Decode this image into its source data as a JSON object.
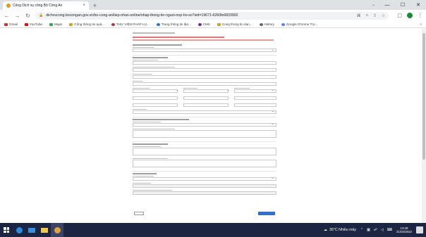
{
  "browser": {
    "tab_title": "Cổng Dịch vụ công Bộ Công An",
    "tab_close": "×",
    "new_tab": "+",
    "url": "dichvucong.bocongan.gov.vn/bo-cong-an/tiep-nhan-online/nhap-thong-tin-nguoi-nop-ho-so?sid=19671-6260fe6833992",
    "bookmarks": [
      {
        "label": "Gmail",
        "color": "#d93025"
      },
      {
        "label": "YouTube",
        "color": "#ff0000"
      },
      {
        "label": "Maps",
        "color": "#34a853"
      },
      {
        "label": "Cổng thông tin quả...",
        "color": "#d8a020"
      },
      {
        "label": "THƯ VIỆN PHÁP LU...",
        "color": "#c62828"
      },
      {
        "label": "Trang thông tin địa...",
        "color": "#1a73e8"
      },
      {
        "label": "CMS",
        "color": "#7b1fa2"
      },
      {
        "label": "Cong thong tin dan...",
        "color": "#d8a020"
      },
      {
        "label": "History",
        "color": "#5f6368"
      },
      {
        "label": "Google Chrome Trợ...",
        "color": "#4285f4"
      }
    ]
  },
  "taskbar": {
    "weather": "35°C Nhiều mây",
    "time": "13:49",
    "date": "21/04/2022"
  },
  "colors": {
    "taskbar": "#1c2541",
    "submit_button": "#2f6fd1",
    "required_text": "#c62828"
  }
}
